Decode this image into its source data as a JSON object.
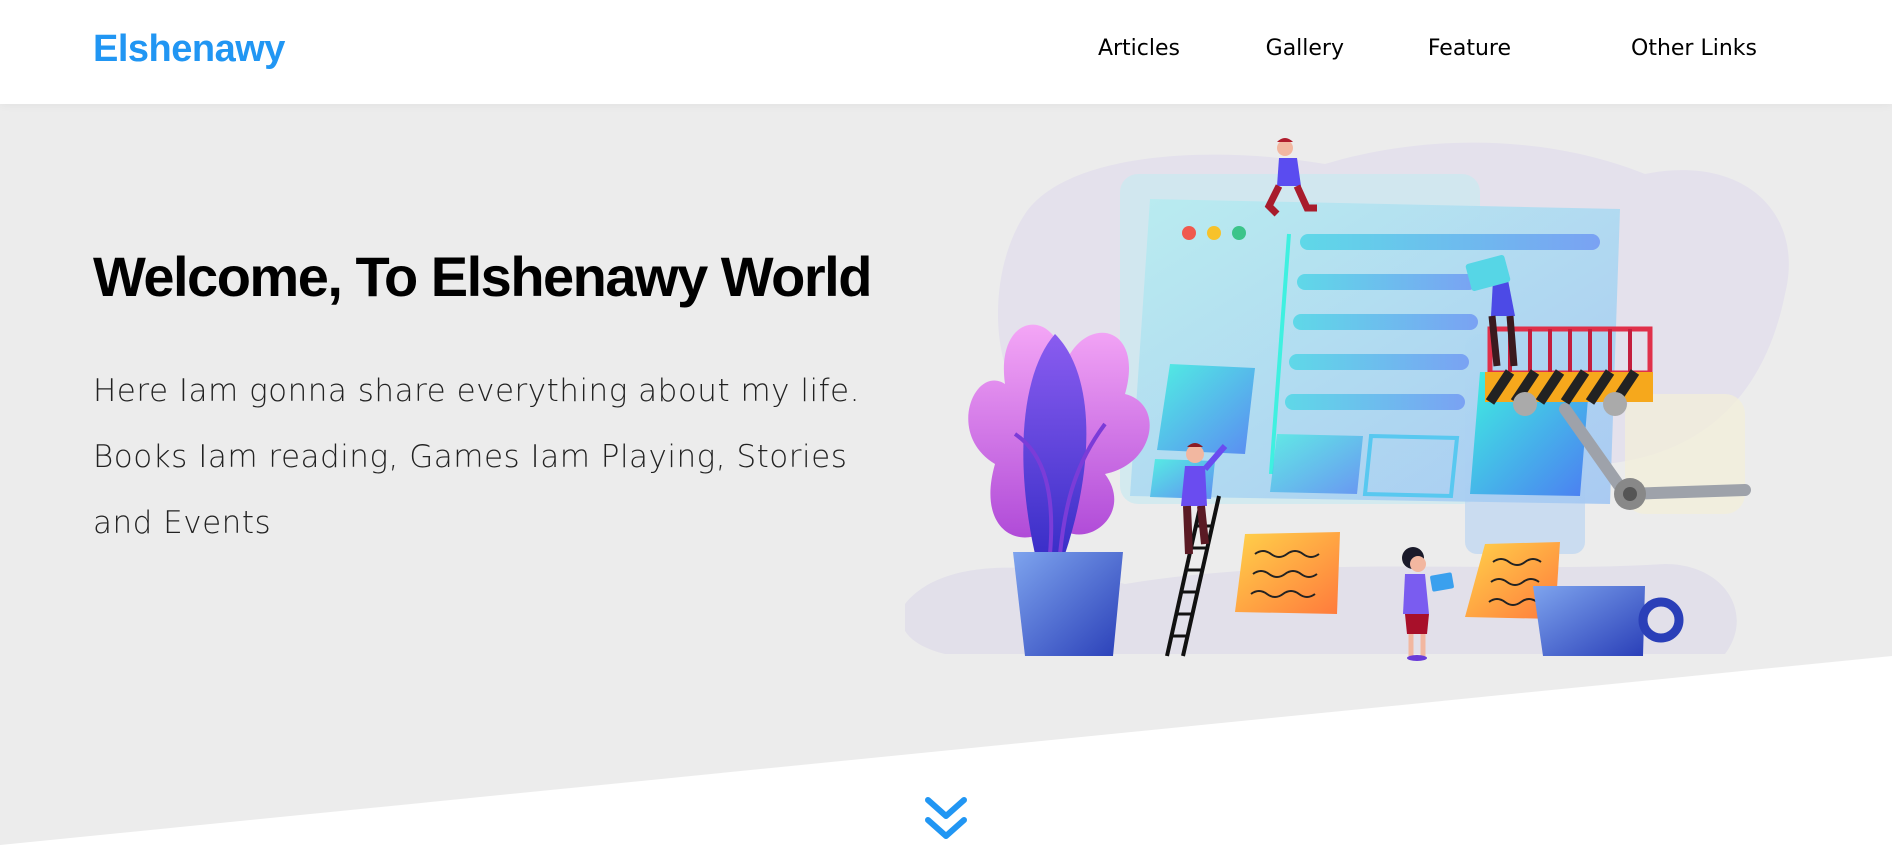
{
  "header": {
    "logo": "Elshenawy",
    "nav": [
      {
        "label": "Articles"
      },
      {
        "label": "Gallery"
      },
      {
        "label": "Feature"
      },
      {
        "label": "Other Links"
      }
    ]
  },
  "landing": {
    "title": "Welcome, To Elshenawy World",
    "description": "Here Iam gonna share everything about my life. Books Iam reading, Games Iam Playing, Stories and Events"
  },
  "colors": {
    "accent": "#2196f3",
    "background": "#ececec"
  },
  "icons": {
    "go_down": "double-chevron-down-icon"
  }
}
